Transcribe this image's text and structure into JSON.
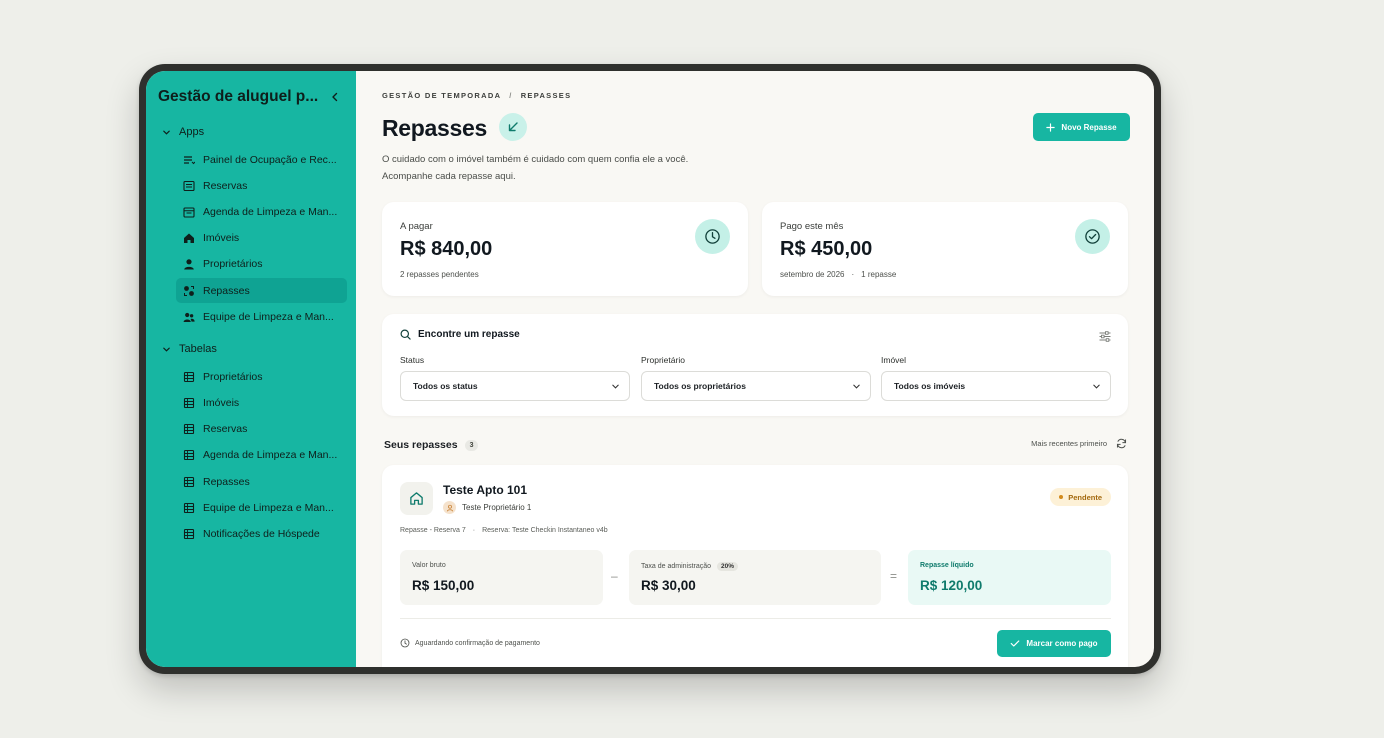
{
  "sidebar": {
    "title": "Gestão de aluguel p...",
    "sections": [
      {
        "label": "Apps"
      },
      {
        "label": "Tabelas"
      }
    ],
    "apps": [
      {
        "label": "Painel de Ocupação e Rec..."
      },
      {
        "label": "Reservas"
      },
      {
        "label": "Agenda de Limpeza e Man..."
      },
      {
        "label": "Imóveis"
      },
      {
        "label": "Proprietários"
      },
      {
        "label": "Repasses",
        "active": true
      },
      {
        "label": "Equipe de Limpeza e Man..."
      }
    ],
    "tables": [
      {
        "label": "Proprietários"
      },
      {
        "label": "Imóveis"
      },
      {
        "label": "Reservas"
      },
      {
        "label": "Agenda de Limpeza e Man..."
      },
      {
        "label": "Repasses"
      },
      {
        "label": "Equipe de Limpeza e Man..."
      },
      {
        "label": "Notificações de Hóspede"
      }
    ]
  },
  "header": {
    "breadcrumb": [
      "GESTÃO DE TEMPORADA",
      "/",
      "REPASSES"
    ],
    "title": "Repasses",
    "subtitle_line1": "O cuidado com o imóvel também é cuidado com quem confia ele a você.",
    "subtitle_line2": "Acompanhe cada repasse aqui.",
    "new_button": "Novo Repasse"
  },
  "stats": [
    {
      "label": "A pagar",
      "value": "R$ 840,00",
      "sub": [
        "2 repasses pendentes"
      ],
      "icon": "clock-icon"
    },
    {
      "label": "Pago este mês",
      "value": "R$ 450,00",
      "sub": [
        "setembro de 2026",
        "·",
        "1 repasse"
      ],
      "icon": "check-circle-icon"
    }
  ],
  "filters": {
    "title": "Encontre um repasse",
    "status": {
      "label": "Status",
      "value": "Todos os status"
    },
    "owner": {
      "label": "Proprietário",
      "value": "Todos os proprietários"
    },
    "property": {
      "label": "Imóvel",
      "value": "Todos os imóveis"
    }
  },
  "list": {
    "title": "Seus repasses",
    "count": "3",
    "sort": "Mais recentes primeiro"
  },
  "repasse": {
    "property": "Teste Apto 101",
    "owner": "Teste Proprietário 1",
    "status": "Pendente",
    "ref": "Repasse - Reserva 7",
    "ref_sep": "·",
    "reservation": "Reserva: Teste Checkin Instantaneo v4b",
    "gross_label": "Valor bruto",
    "gross_value": "R$ 150,00",
    "minus": "–",
    "fee_label": "Taxa de administração",
    "fee_pct": "20%",
    "fee_value": "R$ 30,00",
    "equals": "=",
    "net_label": "Repasse líquido",
    "net_value": "R$ 120,00",
    "awaiting": "Aguardando confirmação de pagamento",
    "pay_button": "Marcar como pago"
  },
  "colors": {
    "accent": "#17b6a2",
    "sidebar_active": "#0fa393",
    "pending": "#a46a0f",
    "net": "#0f7b6c"
  }
}
